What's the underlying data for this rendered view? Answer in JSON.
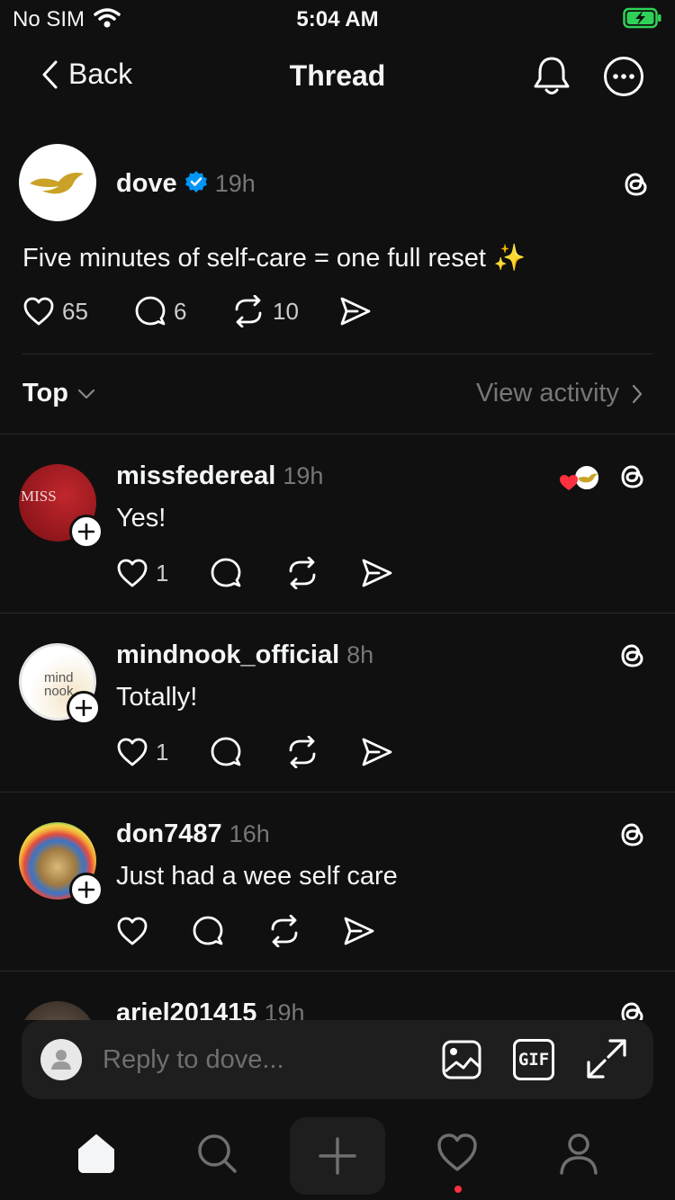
{
  "status_bar": {
    "carrier": "No SIM",
    "time": "5:04 AM"
  },
  "nav": {
    "back_label": "Back",
    "title": "Thread"
  },
  "post": {
    "username": "dove",
    "verified": true,
    "time": "19h",
    "text": "Five minutes of self-care = one full reset ✨",
    "likes": "65",
    "comments": "6",
    "reposts": "10"
  },
  "sort": {
    "label": "Top",
    "view_activity": "View activity"
  },
  "replies": [
    {
      "username": "missfedereal",
      "time": "19h",
      "text": "Yes!",
      "likes": "1",
      "avatar_text": "MISS"
    },
    {
      "username": "mindnook_official",
      "time": "8h",
      "text": "Totally!",
      "likes": "1",
      "avatar_text_1": "mind",
      "avatar_text_2": "nook"
    },
    {
      "username": "don7487",
      "time": "16h",
      "text": "Just had a wee self care",
      "likes": ""
    },
    {
      "username": "ariel201415",
      "time": "19h"
    }
  ],
  "composer": {
    "placeholder": "Reply to dove...",
    "gif_label": "GIF"
  },
  "colors": {
    "background": "#101010",
    "verified": "#0095f6",
    "heart_red": "#ff3040",
    "dove_gold": "#c9a227"
  }
}
